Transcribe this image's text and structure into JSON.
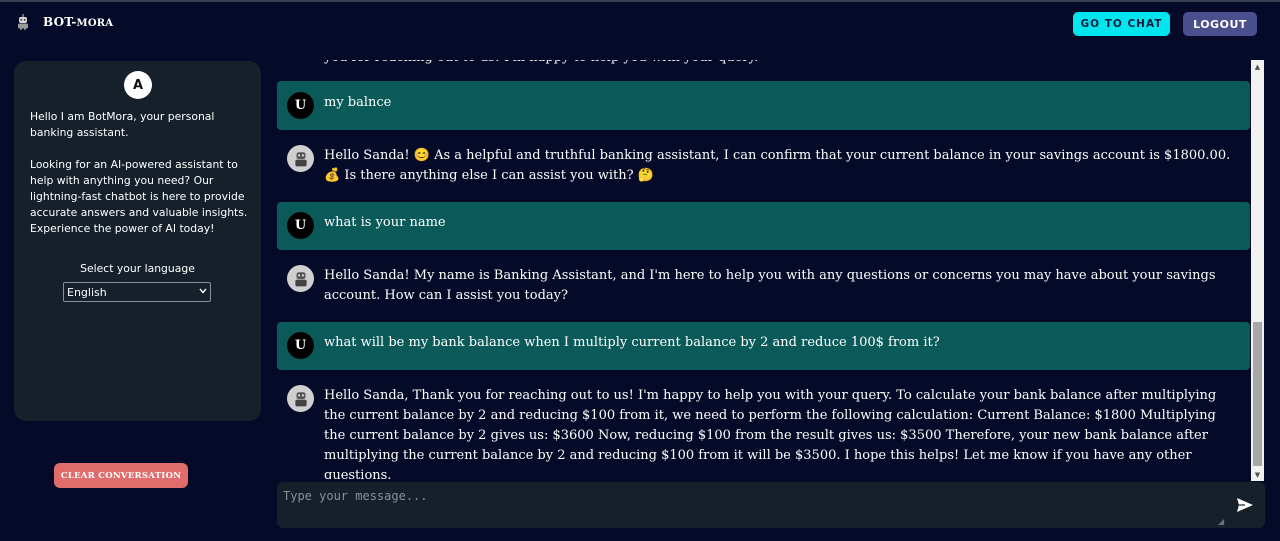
{
  "header": {
    "brand_main": "BOT-",
    "brand_small": "MORA",
    "go_to_chat_label": "GO TO CHAT",
    "logout_label": "LOGOUT"
  },
  "sidebar": {
    "avatar_letter": "A",
    "intro_p1": "Hello I am BotMora, your personal banking assistant.",
    "intro_p2": "Looking for an AI-powered assistant to help with anything you need? Our lightning-fast chatbot is here to provide accurate answers and valuable insights. Experience the power of AI today!",
    "language_label": "Select your language",
    "language_selected": "English",
    "clear_label": "CLEAR CONVERSATION"
  },
  "chat": {
    "user_badge": "U",
    "cut_off_line": "you for reaching out to us! I'm happy to help you with your query.",
    "messages": [
      {
        "role": "user",
        "text": "my balnce"
      },
      {
        "role": "bot",
        "text": "Hello Sanda! 😊 As a helpful and truthful banking assistant, I can confirm that your current balance in your savings account is $1800.00. 💰 Is there anything else I can assist you with? 🤔"
      },
      {
        "role": "user",
        "text": "what is your name"
      },
      {
        "role": "bot",
        "text": "Hello Sanda! My name is Banking Assistant, and I'm here to help you with any questions or concerns you may have about your savings account. How can I assist you today?"
      },
      {
        "role": "user",
        "text": "what will be my bank balance when I multiply current balance by 2 and reduce 100$ from it?"
      },
      {
        "role": "bot",
        "text": "Hello Sanda, Thank you for reaching out to us! I'm happy to help you with your query. To calculate your bank balance after multiplying the current balance by 2 and reducing $100 from it, we need to perform the following calculation: Current Balance: $1800 Multiplying the current balance by 2 gives us: $3600 Now, reducing $100 from the result gives us: $3500 Therefore, your new bank balance after multiplying the current balance by 2 and reducing $100 from it will be $3500. I hope this helps! Let me know if you have any other questions."
      }
    ]
  },
  "composer": {
    "placeholder": "Type your message..."
  },
  "icons": {
    "brand": "robot-icon",
    "bot_avatar": "robot-icon",
    "send": "send-icon"
  },
  "colors": {
    "background": "#050a28",
    "sidebar": "#15202a",
    "user_message": "#0a5a5a",
    "go_to_chat": "#00e5ee",
    "logout": "#4a4f8e",
    "clear": "#e06c6c"
  }
}
